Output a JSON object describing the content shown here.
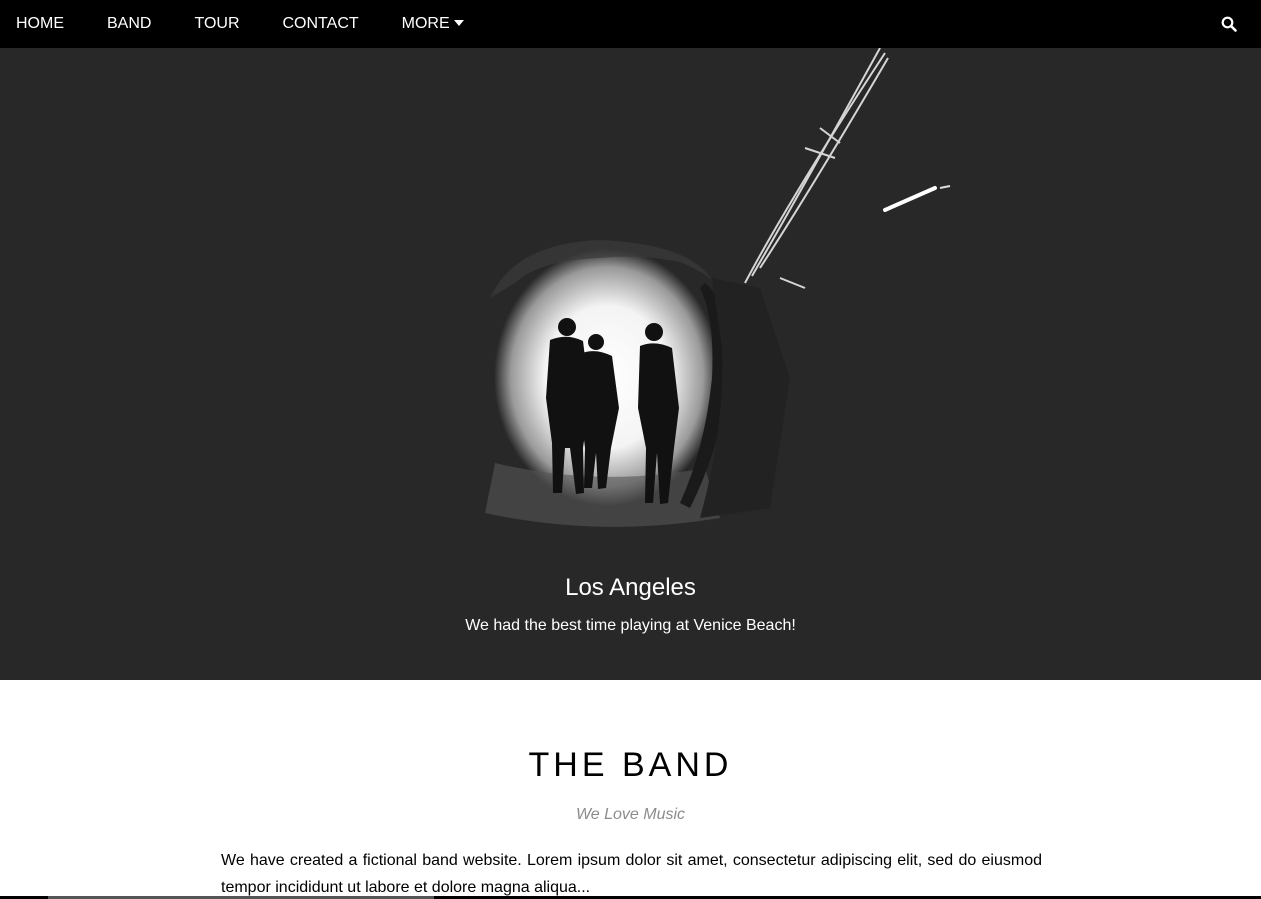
{
  "nav": {
    "items": [
      {
        "label": "HOME"
      },
      {
        "label": "BAND"
      },
      {
        "label": "TOUR"
      },
      {
        "label": "CONTACT"
      },
      {
        "label": "MORE"
      }
    ],
    "search_icon": "search-icon"
  },
  "hero": {
    "title": "Los Angeles",
    "subtitle": "We had the best time playing at Venice Beach!",
    "background_color": "#282828"
  },
  "band": {
    "heading": "THE BAND",
    "tagline": "We Love Music",
    "text": "We have created a fictional band website. Lorem ipsum dolor sit amet, consectetur adipiscing elit, sed do eiusmod tempor incididunt ut labore et dolore magna aliqua..."
  },
  "colors": {
    "nav_bg": "#000000",
    "tagline": "#808080"
  }
}
